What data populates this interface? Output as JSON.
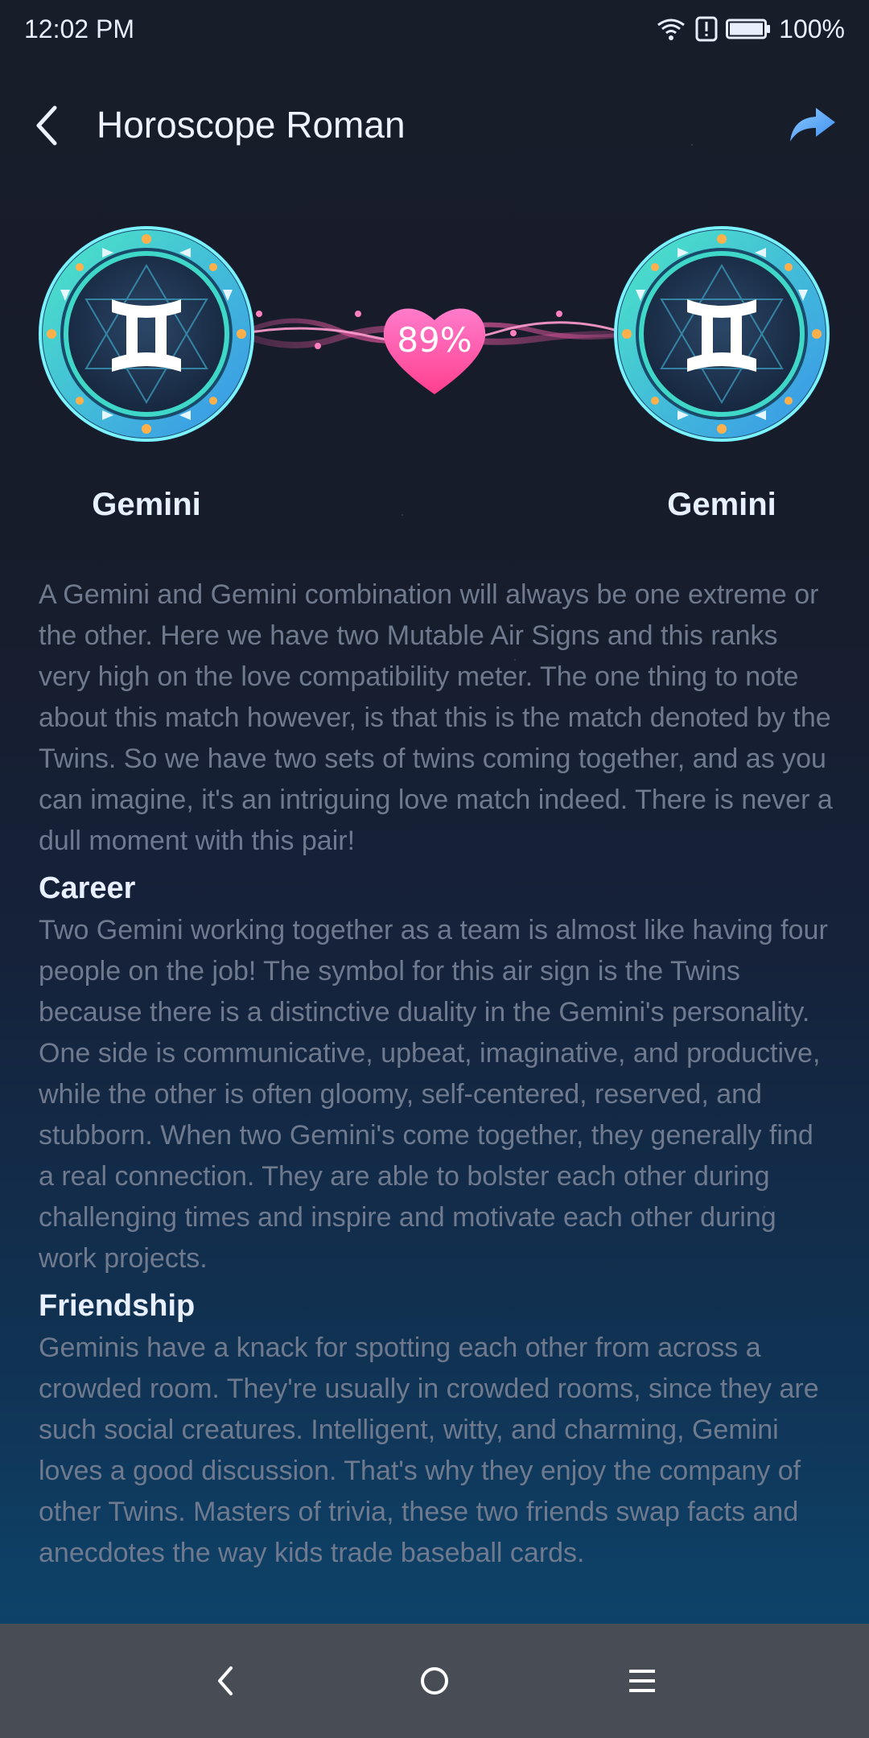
{
  "status_bar": {
    "time": "12:02 PM",
    "battery": "100%"
  },
  "header": {
    "title": "Horoscope Roman"
  },
  "compatibility": {
    "percent": "89%",
    "left_sign": "Gemini",
    "right_sign": "Gemini"
  },
  "content": {
    "intro": "A Gemini and Gemini combination will always be one extreme or the other. Here we have two Mutable Air Signs and this ranks very high on the love compatibility meter. The one thing to note about this match however, is that this is the match denoted by the Twins. So we have two sets of twins coming together, and as you can imagine, it's an intriguing love match indeed. There is never a dull moment with this pair!",
    "sections": [
      {
        "heading": "Career",
        "text": "Two Gemini working together as a team is almost like having four people on the job! The symbol for this air sign is the Twins because there is a distinctive duality in the Gemini's personality. One side is communicative, upbeat, imaginative, and productive, while the other is often gloomy, self-centered, reserved, and stubborn. When two Gemini's come together, they generally find a real connection. They are able to bolster each other during challenging times and inspire and motivate each other during work projects."
      },
      {
        "heading": "Friendship",
        "text": "Geminis have a knack for spotting each other from across a crowded room. They're usually in crowded rooms, since they are such social creatures. Intelligent, witty, and charming, Gemini loves a good discussion. That's why they enjoy the company of other Twins. Masters of trivia, these two friends swap facts and anecdotes the way kids trade baseball cards."
      }
    ]
  },
  "icons": {
    "back": "chevron-left-icon",
    "share": "share-arrow-icon",
    "sign": "gemini-symbol-icon",
    "heart": "heart-icon",
    "nav_back": "nav-back-icon",
    "nav_home": "nav-home-icon",
    "nav_menu": "nav-menu-icon"
  },
  "colors": {
    "accent_blue": "#6ab4ff",
    "heart_pink": "#ff4fa0",
    "badge_teal": "#2ed3c6",
    "nav_bar": "#474c55"
  }
}
